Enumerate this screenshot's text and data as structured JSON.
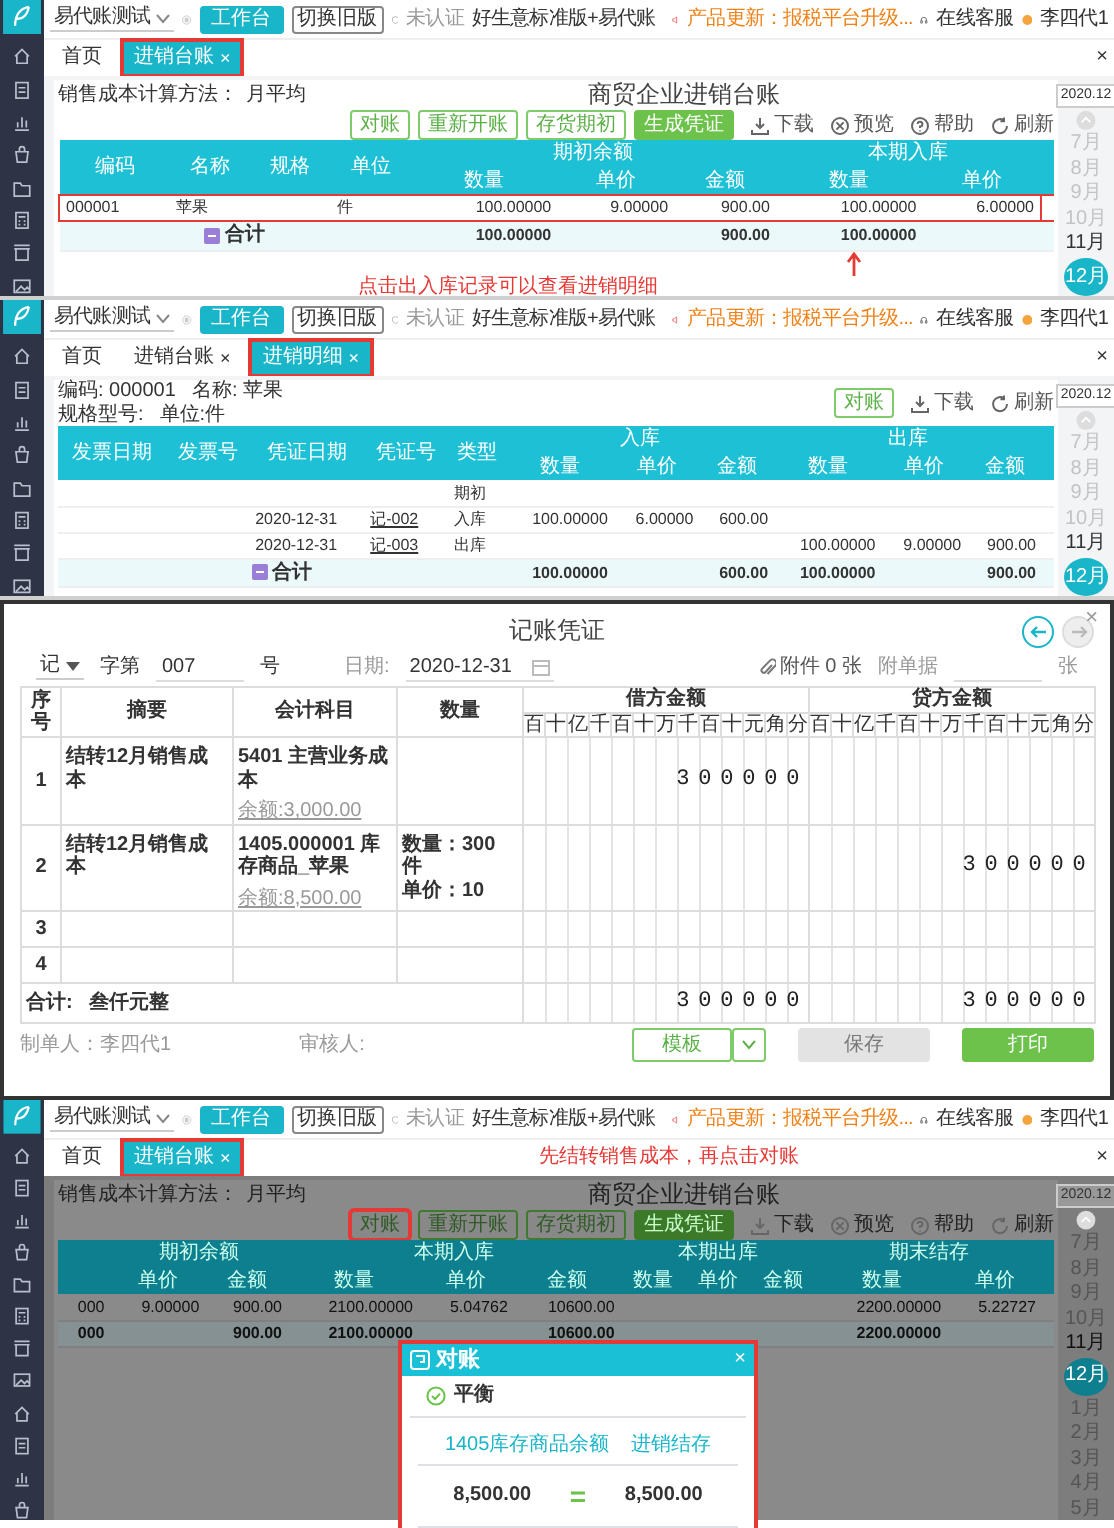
{
  "ledger_screen": {
    "topbar": {
      "company": "易代账测试",
      "workbench": "工作台",
      "old_version": "切换旧版",
      "certification": "未认证",
      "edition": "好生意标准版+易代账",
      "notice": "产品更新：报税平台升级...",
      "support": "在线客服",
      "user": "李四代1"
    },
    "tabs": [
      {
        "label": "首页",
        "selected": false,
        "highlighted": false
      },
      {
        "label": "进销台账",
        "close": "×",
        "selected": true,
        "highlighted": true
      }
    ],
    "tabs_close": "×",
    "method_label": "销售成本计算方法：",
    "method_value": "月平均",
    "title": "商贸企业进销台账",
    "actions": [
      {
        "label": "对账",
        "kind": "outline",
        "highlighted": false
      },
      {
        "label": "重新开账",
        "kind": "outline",
        "highlighted": false
      },
      {
        "label": "存货期初",
        "kind": "outline",
        "highlighted": false
      },
      {
        "label": "生成凭证",
        "kind": "solid",
        "highlighted": false
      }
    ],
    "links": [
      {
        "label": "下载",
        "kind": "download"
      },
      {
        "label": "预览",
        "kind": "preview"
      },
      {
        "label": "帮助",
        "kind": "help"
      },
      {
        "label": "刷新",
        "kind": "refresh"
      }
    ],
    "table": {
      "columns": [
        {
          "label": "编码",
          "kind": "single"
        },
        {
          "label": "名称",
          "kind": "single"
        },
        {
          "label": "规格",
          "kind": "single"
        },
        {
          "label": "单位",
          "kind": "single"
        },
        {
          "label": "期初余额",
          "kind": "group",
          "colspan": 3,
          "sub": [
            "数量",
            "单价",
            "金额"
          ]
        },
        {
          "label": "本期入库",
          "kind": "group",
          "colspan": 2,
          "sub": [
            "数量",
            "单价"
          ]
        }
      ],
      "rows": [
        {
          "kind": "data",
          "highlighted": true,
          "cells": [
            "000001",
            "苹果",
            null,
            "件",
            "100.00000",
            "9.00000",
            "900.00",
            "100.00000",
            "6.00000"
          ]
        },
        {
          "kind": "total",
          "highlighted": false,
          "label": "合计",
          "cells": [
            null,
            null,
            null,
            null,
            "100.00000",
            null,
            "900.00",
            "100.00000",
            null
          ]
        }
      ]
    },
    "annotation": "点击出入库记录可以查看进销明细",
    "date_rail": {
      "period": "2020.12",
      "months": [
        {
          "label": "7月",
          "disabled": true,
          "selected": false
        },
        {
          "label": "8月",
          "disabled": true,
          "selected": false
        },
        {
          "label": "9月",
          "disabled": true,
          "selected": false
        },
        {
          "label": "10月",
          "disabled": true,
          "selected": false
        },
        {
          "label": "11月",
          "disabled": false,
          "selected": false
        },
        {
          "label": "12月",
          "disabled": false,
          "selected": true
        }
      ]
    }
  },
  "detail_screen": {
    "topbar": {
      "company": "易代账测试",
      "workbench": "工作台",
      "old_version": "切换旧版",
      "certification": "未认证",
      "edition": "好生意标准版+易代账",
      "notice": "产品更新：报税平台升级...",
      "support": "在线客服",
      "user": "李四代1"
    },
    "tabs": [
      {
        "label": "首页",
        "selected": false,
        "highlighted": false
      },
      {
        "label": "进销台账",
        "close": "×",
        "selected": false,
        "highlighted": false
      },
      {
        "label": "进销明细",
        "close": "×",
        "selected": true,
        "highlighted": true
      }
    ],
    "tabs_close": "×",
    "info_lines": [
      [
        "编码: 000001",
        "名称: 苹果"
      ],
      [
        "规格型号:",
        "单位:件"
      ]
    ],
    "actions": [
      {
        "label": "对账",
        "kind": "outline",
        "highlighted": false
      }
    ],
    "links": [
      {
        "label": "下载",
        "kind": "download"
      },
      {
        "label": "刷新",
        "kind": "refresh"
      }
    ],
    "table": {
      "columns": [
        {
          "label": "发票日期",
          "kind": "single"
        },
        {
          "label": "发票号",
          "kind": "single"
        },
        {
          "label": "凭证日期",
          "kind": "single"
        },
        {
          "label": "凭证号",
          "kind": "link"
        },
        {
          "label": "类型",
          "kind": "single"
        },
        {
          "label": "入库",
          "kind": "group",
          "colspan": 3,
          "sub": [
            "数量",
            "单价",
            "金额"
          ]
        },
        {
          "label": "出库",
          "kind": "group",
          "colspan": 3,
          "sub": [
            "数量",
            "单价",
            "金额"
          ]
        }
      ],
      "rows": [
        {
          "kind": "data",
          "highlighted": false,
          "cells": [
            null,
            null,
            null,
            null,
            "期初",
            null,
            null,
            null,
            null,
            null,
            null
          ]
        },
        {
          "kind": "data",
          "highlighted": false,
          "cells": [
            null,
            null,
            "2020-12-31",
            "记-002",
            "入库",
            "100.00000",
            "6.00000",
            "600.00",
            null,
            null,
            null
          ]
        },
        {
          "kind": "data",
          "highlighted": false,
          "cells": [
            null,
            null,
            "2020-12-31",
            "记-003",
            "出库",
            null,
            null,
            null,
            "100.00000",
            "9.00000",
            "900.00"
          ]
        },
        {
          "kind": "total",
          "highlighted": false,
          "label": "合计",
          "cells": [
            null,
            null,
            null,
            null,
            null,
            "100.00000",
            null,
            "600.00",
            "100.00000",
            null,
            "900.00"
          ]
        }
      ]
    },
    "date_rail": {
      "period": "2020.12",
      "months": [
        {
          "label": "7月",
          "disabled": true,
          "selected": false
        },
        {
          "label": "8月",
          "disabled": true,
          "selected": false
        },
        {
          "label": "9月",
          "disabled": true,
          "selected": false
        },
        {
          "label": "10月",
          "disabled": true,
          "selected": false
        },
        {
          "label": "11月",
          "disabled": false,
          "selected": false
        },
        {
          "label": "12月",
          "disabled": false,
          "selected": true
        }
      ]
    }
  },
  "voucher_dialog": {
    "title": "记账凭证",
    "close": "×",
    "nav": [
      {
        "kind": "prev",
        "disabled": false
      },
      {
        "kind": "next",
        "disabled": true
      }
    ],
    "voucher_type": "记",
    "word_label": "字第",
    "number": "007",
    "number_suffix": "号",
    "date_label": "日期:",
    "date": "2020-12-31",
    "attachment": "附件 0 张",
    "doc_label": "附单据",
    "doc_suffix": "张",
    "columns": [
      "序号",
      "摘要",
      "会计科目",
      "数量"
    ],
    "debit_label": "借方金额",
    "credit_label": "贷方金额",
    "debit_units": [
      "百",
      "十",
      "亿",
      "千",
      "百",
      "十",
      "万",
      "千",
      "百",
      "十",
      "元",
      "角",
      "分"
    ],
    "credit_units": [
      "百",
      "十",
      "亿",
      "千",
      "百",
      "十",
      "万",
      "千",
      "百",
      "十",
      "元",
      "角",
      "分"
    ],
    "rows": [
      {
        "no": "1",
        "summary": "结转12月销售成本",
        "account": "5401 主营业务成本",
        "balance": "余额:3,000.00",
        "debit": "300000"
      },
      {
        "no": "2",
        "summary": "结转12月销售成本",
        "account": "1405.000001 库存商品_苹果",
        "balance": "余额:8,500.00",
        "quantity": [
          "数量：300 件",
          "单价：10"
        ],
        "credit": "300000"
      },
      {
        "no": "3"
      },
      {
        "no": "4"
      }
    ],
    "total": {
      "label": "合计:",
      "amount_words": "叁仟元整",
      "debit": "300000",
      "credit": "300000"
    },
    "maker": "制单人：李四代1",
    "reviewer": "审核人:",
    "buttons": [
      {
        "label": "模板",
        "kind": "split",
        "disabled": false
      },
      {
        "label": "保存",
        "kind": "secondary",
        "disabled": true
      },
      {
        "label": "打印",
        "kind": "primary",
        "disabled": false
      }
    ]
  },
  "reconcile_screen": {
    "topbar": {
      "company": "易代账测试",
      "workbench": "工作台",
      "old_version": "切换旧版",
      "certification": "未认证",
      "edition": "好生意标准版+易代账",
      "notice": "产品更新：报税平台升级...",
      "support": "在线客服",
      "user": "李四代1"
    },
    "tabs": [
      {
        "label": "首页",
        "selected": false,
        "highlighted": false
      },
      {
        "label": "进销台账",
        "close": "×",
        "selected": true,
        "highlighted": true
      }
    ],
    "tab_annotation": "先结转销售成本，再点击对账",
    "tabs_close": "×",
    "dimmed": true,
    "method_label": "销售成本计算方法：",
    "method_value": "月平均",
    "title": "商贸企业进销台账",
    "actions": [
      {
        "label": "对账",
        "kind": "outline",
        "highlighted": true
      },
      {
        "label": "重新开账",
        "kind": "outline",
        "highlighted": false
      },
      {
        "label": "存货期初",
        "kind": "outline",
        "highlighted": false
      },
      {
        "label": "生成凭证",
        "kind": "solid",
        "highlighted": false
      }
    ],
    "links": [
      {
        "label": "下载",
        "kind": "download"
      },
      {
        "label": "预览",
        "kind": "preview"
      },
      {
        "label": "帮助",
        "kind": "help"
      },
      {
        "label": "刷新",
        "kind": "refresh"
      }
    ],
    "table": {
      "columns": [
        {
          "kind": "blank"
        },
        {
          "label": "期初余额",
          "kind": "group",
          "colspan": 2,
          "sub": [
            "单价",
            "金额"
          ]
        },
        {
          "label": "本期入库",
          "kind": "group",
          "colspan": 3,
          "sub": [
            "数量",
            "单价",
            "金额"
          ]
        },
        {
          "label": "本期出库",
          "kind": "group",
          "colspan": 3,
          "sub": [
            "数量",
            "单价",
            "金额"
          ]
        },
        {
          "label": "期末结存",
          "kind": "group",
          "colspan": 2,
          "sub": [
            "数量",
            "单价"
          ]
        }
      ],
      "rows": [
        {
          "kind": "data",
          "highlighted": false,
          "cells": [
            "000",
            "9.00000",
            "900.00",
            "2100.00000",
            "5.04762",
            "10600.00",
            null,
            null,
            null,
            "2200.00000",
            "5.22727"
          ]
        },
        {
          "kind": "total",
          "highlighted": false,
          "cells": [
            "000",
            null,
            "900.00",
            "2100.00000",
            null,
            "10600.00",
            null,
            null,
            null,
            "2200.00000",
            null
          ]
        }
      ]
    },
    "date_rail": {
      "period": "2020.12",
      "months": [
        {
          "label": "7月",
          "disabled": true,
          "selected": false
        },
        {
          "label": "8月",
          "disabled": true,
          "selected": false
        },
        {
          "label": "9月",
          "disabled": true,
          "selected": false
        },
        {
          "label": "10月",
          "disabled": true,
          "selected": false
        },
        {
          "label": "11月",
          "disabled": false,
          "selected": false
        },
        {
          "label": "12月",
          "disabled": false,
          "selected": true
        },
        {
          "label": "1月",
          "disabled": true,
          "selected": false
        },
        {
          "label": "2月",
          "disabled": true,
          "selected": false
        },
        {
          "label": "3月",
          "disabled": true,
          "selected": false
        },
        {
          "label": "4月",
          "disabled": true,
          "selected": false
        },
        {
          "label": "5月",
          "disabled": true,
          "selected": false
        }
      ]
    },
    "modal": {
      "title": "对账",
      "close": "×",
      "highlighted": true,
      "balanced": true,
      "status": "平衡",
      "left_label": "1405库存商品余额",
      "right_label": "进销结存",
      "left_value": "8,500.00",
      "equals": "=",
      "right_value": "8,500.00"
    }
  }
}
